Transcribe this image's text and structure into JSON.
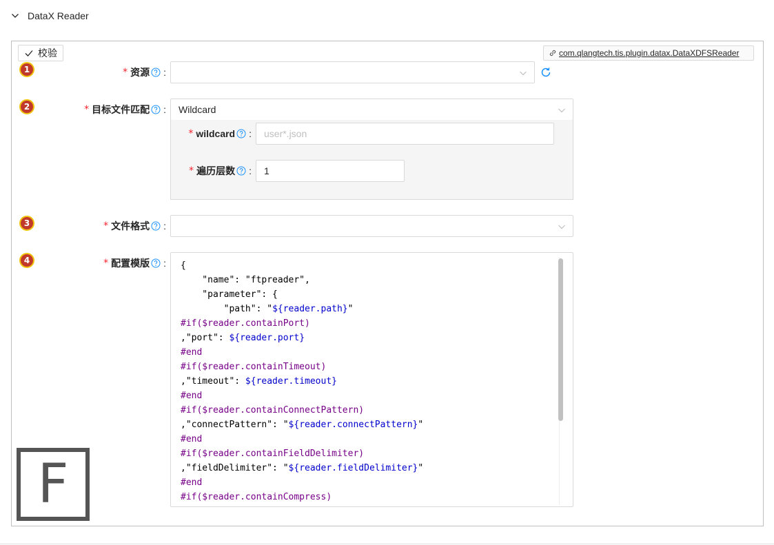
{
  "section": {
    "title": "DataX Reader"
  },
  "toolbar": {
    "verify_label": "校验",
    "plugin_link": "com.qlangtech.tis.plugin.datax.DataXDFSReader"
  },
  "badges": [
    "1",
    "2",
    "3",
    "4"
  ],
  "fields": {
    "resource": {
      "label": "资源",
      "value": ""
    },
    "target_match": {
      "label": "目标文件匹配",
      "value": "Wildcard",
      "wildcard": {
        "label": "wildcard",
        "placeholder": "user*.json",
        "value": ""
      },
      "depth": {
        "label": "遍历层数",
        "value": "1"
      }
    },
    "file_format": {
      "label": "文件格式",
      "value": ""
    },
    "template": {
      "label": "配置模版"
    }
  },
  "code_lines": [
    [
      {
        "t": "{",
        "c": "plain"
      }
    ],
    [
      {
        "t": "    \"name\": \"ftpreader\",",
        "c": "plain"
      }
    ],
    [
      {
        "t": "    \"parameter\": {",
        "c": "plain"
      }
    ],
    [
      {
        "t": "        \"path\": \"",
        "c": "plain"
      },
      {
        "t": "${reader.path}",
        "c": "var"
      },
      {
        "t": "\"",
        "c": "plain"
      }
    ],
    [
      {
        "t": "#if($reader.containPort)",
        "c": "dir"
      }
    ],
    [
      {
        "t": ",\"port\": ",
        "c": "plain"
      },
      {
        "t": "${reader.port}",
        "c": "var"
      }
    ],
    [
      {
        "t": "#end",
        "c": "dir"
      }
    ],
    [
      {
        "t": "#if($reader.containTimeout)",
        "c": "dir"
      }
    ],
    [
      {
        "t": ",\"timeout\": ",
        "c": "plain"
      },
      {
        "t": "${reader.timeout}",
        "c": "var"
      }
    ],
    [
      {
        "t": "#end",
        "c": "dir"
      }
    ],
    [
      {
        "t": "#if($reader.containConnectPattern)",
        "c": "dir"
      }
    ],
    [
      {
        "t": ",\"connectPattern\": \"",
        "c": "plain"
      },
      {
        "t": "${reader.connectPattern}",
        "c": "var"
      },
      {
        "t": "\"",
        "c": "plain"
      }
    ],
    [
      {
        "t": "#end",
        "c": "dir"
      }
    ],
    [
      {
        "t": "#if($reader.containFieldDelimiter)",
        "c": "dir"
      }
    ],
    [
      {
        "t": ",\"fieldDelimiter\": \"",
        "c": "plain"
      },
      {
        "t": "${reader.fieldDelimiter}",
        "c": "var"
      },
      {
        "t": "\"",
        "c": "plain"
      }
    ],
    [
      {
        "t": "#end",
        "c": "dir"
      }
    ],
    [
      {
        "t": "#if($reader.containCompress)",
        "c": "dir"
      }
    ]
  ],
  "logo": {
    "letter": "F"
  },
  "colors": {
    "required": "#f5222d",
    "help": "#1890ff",
    "badge_fill": "#c0392b",
    "badge_ring": "#f1c40f",
    "directive": "#770088",
    "variable": "#0000cc"
  }
}
